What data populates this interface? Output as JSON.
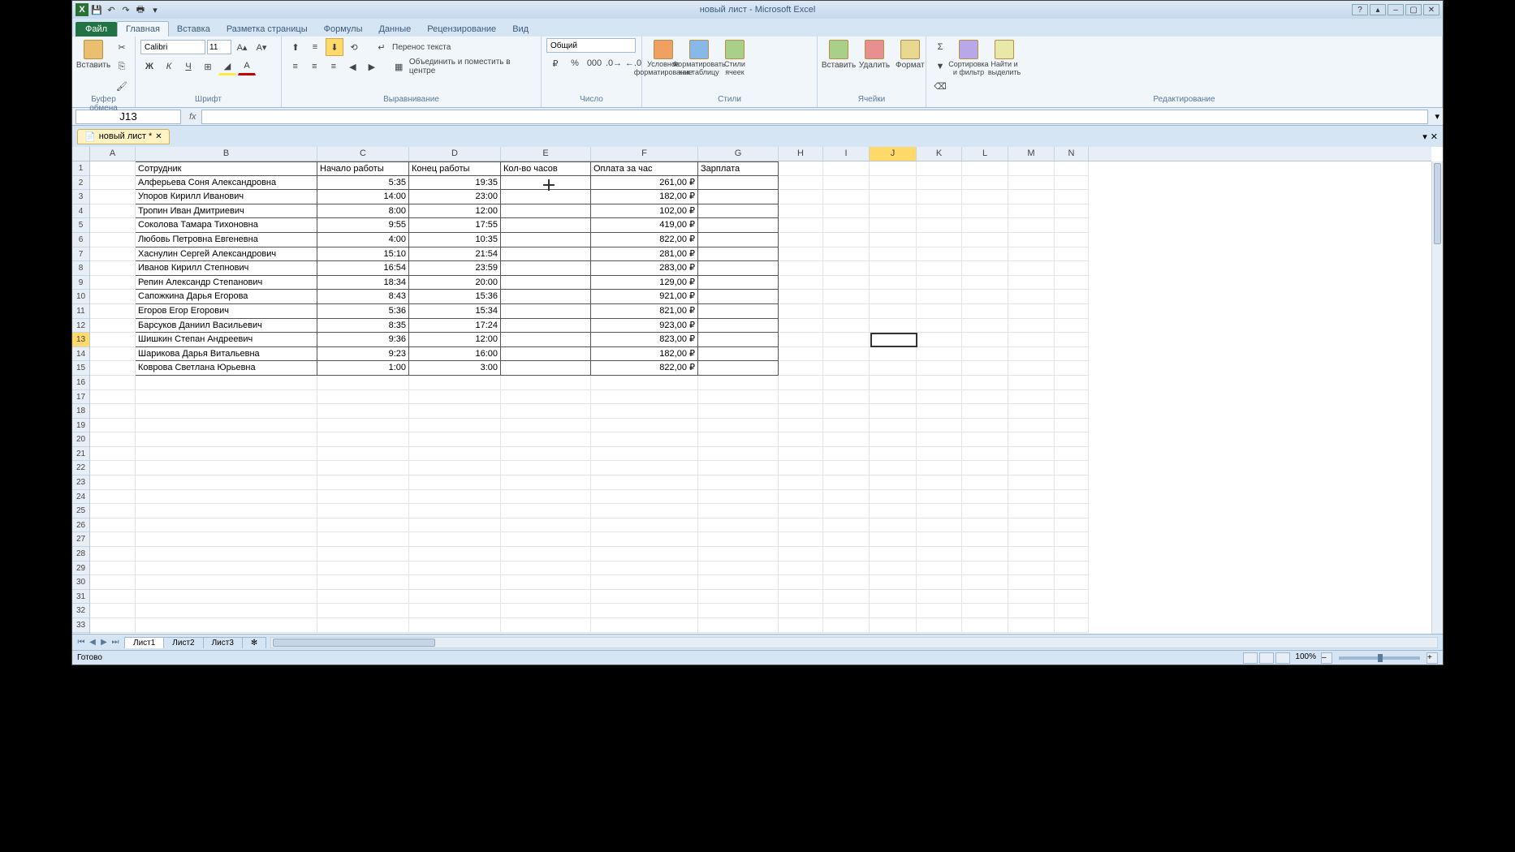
{
  "app": {
    "title": "новый лист - Microsoft Excel"
  },
  "qat": {
    "excel": "X",
    "save": "💾",
    "undo": "↶",
    "redo": "↷",
    "print": "🖶"
  },
  "tabs": {
    "file": "Файл",
    "items": [
      "Главная",
      "Вставка",
      "Разметка страницы",
      "Формулы",
      "Данные",
      "Рецензирование",
      "Вид"
    ]
  },
  "ribbon": {
    "clipboard": {
      "label": "Буфер обмена",
      "paste": "Вставить"
    },
    "font": {
      "label": "Шрифт",
      "name": "Calibri",
      "size": "11",
      "bold": "Ж",
      "italic": "К",
      "underline": "Ч"
    },
    "alignment": {
      "label": "Выравнивание",
      "wrap": "Перенос текста",
      "merge": "Объединить и поместить в центре"
    },
    "number": {
      "label": "Число",
      "format": "Общий"
    },
    "styles": {
      "label": "Стили",
      "cond": "Условное форматирование",
      "table": "Форматировать как таблицу",
      "cell": "Стили ячеек"
    },
    "cells": {
      "label": "Ячейки",
      "insert": "Вставить",
      "delete": "Удалить",
      "format": "Формат"
    },
    "editing": {
      "label": "Редактирование",
      "sort": "Сортировка и фильтр",
      "find": "Найти и выделить"
    }
  },
  "fbar": {
    "namebox": "J13",
    "fx": "fx",
    "formula": ""
  },
  "doctab": {
    "name": "новый лист *"
  },
  "columns": [
    "A",
    "B",
    "C",
    "D",
    "E",
    "F",
    "G",
    "H",
    "I",
    "J",
    "K",
    "L",
    "M",
    "N"
  ],
  "headers": {
    "b": "Сотрудник",
    "c": "Начало работы",
    "d": "Конец работы",
    "e": "Кол-во часов",
    "f": "Оплата за час",
    "g": "Зарплата"
  },
  "rows": [
    {
      "b": "Алферьева Соня Александровна",
      "c": "5:35",
      "d": "19:35",
      "e": "",
      "f": "261,00 ₽",
      "g": ""
    },
    {
      "b": "Упоров Кирилл Иванович",
      "c": "14:00",
      "d": "23:00",
      "e": "",
      "f": "182,00 ₽",
      "g": ""
    },
    {
      "b": "Тропин Иван Дмитриевич",
      "c": "8:00",
      "d": "12:00",
      "e": "",
      "f": "102,00 ₽",
      "g": ""
    },
    {
      "b": "Соколова Тамара Тихоновна",
      "c": "9:55",
      "d": "17:55",
      "e": "",
      "f": "419,00 ₽",
      "g": ""
    },
    {
      "b": "Любовь Петровна Евгеневна",
      "c": "4:00",
      "d": "10:35",
      "e": "",
      "f": "822,00 ₽",
      "g": ""
    },
    {
      "b": "Хаснулин Сергей Александрович",
      "c": "15:10",
      "d": "21:54",
      "e": "",
      "f": "281,00 ₽",
      "g": ""
    },
    {
      "b": "Иванов Кирилл Степнович",
      "c": "16:54",
      "d": "23:59",
      "e": "",
      "f": "283,00 ₽",
      "g": ""
    },
    {
      "b": "Репин Александр Степанович",
      "c": "18:34",
      "d": "20:00",
      "e": "",
      "f": "129,00 ₽",
      "g": ""
    },
    {
      "b": "Сапожкина Дарья Егорова",
      "c": "8:43",
      "d": "15:36",
      "e": "",
      "f": "921,00 ₽",
      "g": ""
    },
    {
      "b": "Егоров Егор Егорович",
      "c": "5:36",
      "d": "15:34",
      "e": "",
      "f": "821,00 ₽",
      "g": ""
    },
    {
      "b": "Барсуков Даниил Васильевич",
      "c": "8:35",
      "d": "17:24",
      "e": "",
      "f": "923,00 ₽",
      "g": ""
    },
    {
      "b": "Шишкин Степан Андреевич",
      "c": "9:36",
      "d": "12:00",
      "e": "",
      "f": "823,00 ₽",
      "g": ""
    },
    {
      "b": "Шарикова Дарья Витальевна",
      "c": "9:23",
      "d": "16:00",
      "e": "",
      "f": "182,00 ₽",
      "g": ""
    },
    {
      "b": "Коврова Светлана Юрьевна",
      "c": "1:00",
      "d": "3:00",
      "e": "",
      "f": "822,00 ₽",
      "g": ""
    }
  ],
  "sheets": {
    "names": [
      "Лист1",
      "Лист2",
      "Лист3"
    ],
    "new": "✻"
  },
  "status": {
    "ready": "Готово",
    "zoom": "100%"
  },
  "selection": {
    "cell": "J13",
    "row": 13,
    "col": "J"
  }
}
